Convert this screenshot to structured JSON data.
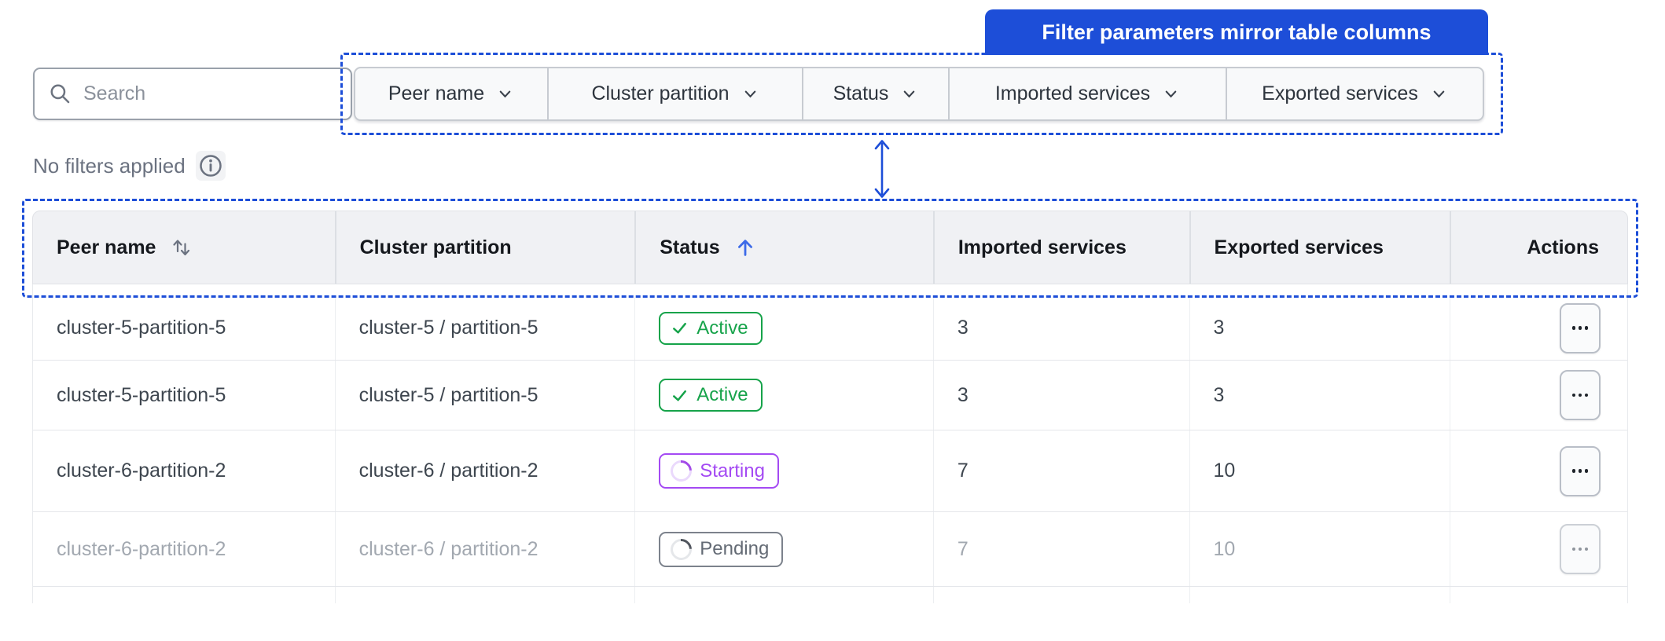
{
  "annotation": {
    "banner_label": "Filter parameters mirror table columns",
    "accent_color": "#1d4ed8"
  },
  "filter_bar": {
    "search_placeholder": "Search",
    "no_filters_text": "No filters applied",
    "filters": {
      "peer_name": "Peer name",
      "cluster_partition": "Cluster partition",
      "status": "Status",
      "imported_services": "Imported services",
      "exported_services": "Exported services"
    }
  },
  "table": {
    "columns": {
      "peer_name": "Peer name",
      "cluster_partition": "Cluster partition",
      "status": "Status",
      "imported_services": "Imported services",
      "exported_services": "Exported services",
      "actions": "Actions"
    },
    "sort": {
      "peer_name": "unsorted",
      "status": "ascending"
    },
    "rows": [
      {
        "peer_name": "cluster-5-partition-5",
        "cluster_partition": "cluster-5 / partition-5",
        "status": "Active",
        "imported": "3",
        "exported": "3"
      },
      {
        "peer_name": "cluster-5-partition-5",
        "cluster_partition": "cluster-5 / partition-5",
        "status": "Active",
        "imported": "3",
        "exported": "3"
      },
      {
        "peer_name": "cluster-6-partition-2",
        "cluster_partition": "cluster-6 / partition-2",
        "status": "Starting",
        "imported": "7",
        "exported": "10"
      },
      {
        "peer_name": "cluster-6-partition-2",
        "cluster_partition": "cluster-6 / partition-2",
        "status": "Pending",
        "imported": "7",
        "exported": "10"
      }
    ]
  },
  "status_colors": {
    "active": "#16a34a",
    "starting": "#a44af3",
    "pending": "#6b7280"
  }
}
